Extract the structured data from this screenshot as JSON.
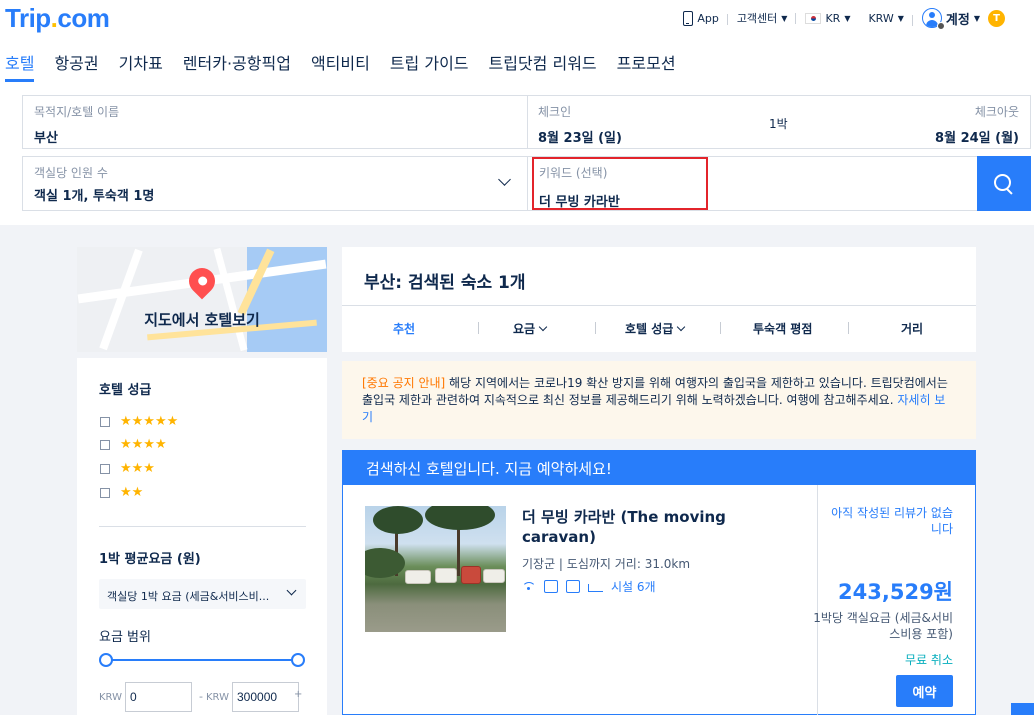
{
  "header": {
    "logo_main": "Trip",
    "logo_dot": ".",
    "logo_tld": "com",
    "util": {
      "app_label": "App",
      "support_label": "고객센터",
      "lang_label": "KR",
      "currency_label": "KRW",
      "account_label": "계정",
      "coin_label": "T"
    },
    "nav": [
      "호텔",
      "항공권",
      "기차표",
      "렌터카·공항픽업",
      "액티비티",
      "트립 가이드",
      "트립닷컴 리워드",
      "프로모션"
    ]
  },
  "search": {
    "dest_label": "목적지/호텔 이름",
    "dest_value": "부산",
    "checkin_label": "체크인",
    "checkin_value": "8월 23일 (일)",
    "nights": "1박",
    "checkout_label": "체크아웃",
    "checkout_value": "8월 24일 (월)",
    "guests_label": "객실당 인원 수",
    "guests_value": "객실 1개, 투숙객 1명",
    "keyword_label": "키워드 (선택)",
    "keyword_value": "더 무빙 카라반"
  },
  "sidebar": {
    "map_label": "지도에서 호텔보기",
    "rating_title": "호텔 성급",
    "star_rows": [
      "★★★★★",
      "★★★★",
      "★★★",
      "★★"
    ],
    "price_title": "1박 평균요금 (원)",
    "price_select": "객실당 1박 요금 (세금&서비스비...",
    "range_title": "요금 범위",
    "range_unit": "KRW",
    "range_min": "0",
    "range_dash": "-",
    "range_max": "300000",
    "range_plus": "+"
  },
  "results": {
    "title": "부산: 검색된 숙소 1개",
    "sort": [
      "추천",
      "요금",
      "호텔 성급",
      "투숙객 평점",
      "거리"
    ],
    "notice_tag": "[중요 공지 안내]",
    "notice_text": " 해당 지역에서는 코로나19 확산 방지를 위해 여행자의 출입국을 제한하고 있습니다. 트립닷컴에서는 출입국 제한과 관련하여 지속적으로 최신 정보를 제공해드리기 위해 노력하겠습니다. 여행에 참고해주세요. ",
    "notice_link": "자세히 보기",
    "banner": "검색하신 호텔입니다. 지금 예약하세요!",
    "hotel": {
      "name": "더 무빙 카라반 (The moving caravan)",
      "location": "기장군 | 도심까지 거리: 31.0km",
      "facilities": "시설 6개",
      "no_review": "아직 작성된 리뷰가 없습니다",
      "price": "243,529원",
      "price_note": "1박당 객실요금 (세금&서비스비용 포함)",
      "free_cancel": "무료 취소",
      "book_label": "예약"
    }
  },
  "colors": {
    "brand_blue": "#287dfa",
    "star_yellow": "#ffb400",
    "notice_orange": "#ff7700",
    "highlight_red": "#e3242b",
    "free_cancel_teal": "#06aebd"
  }
}
